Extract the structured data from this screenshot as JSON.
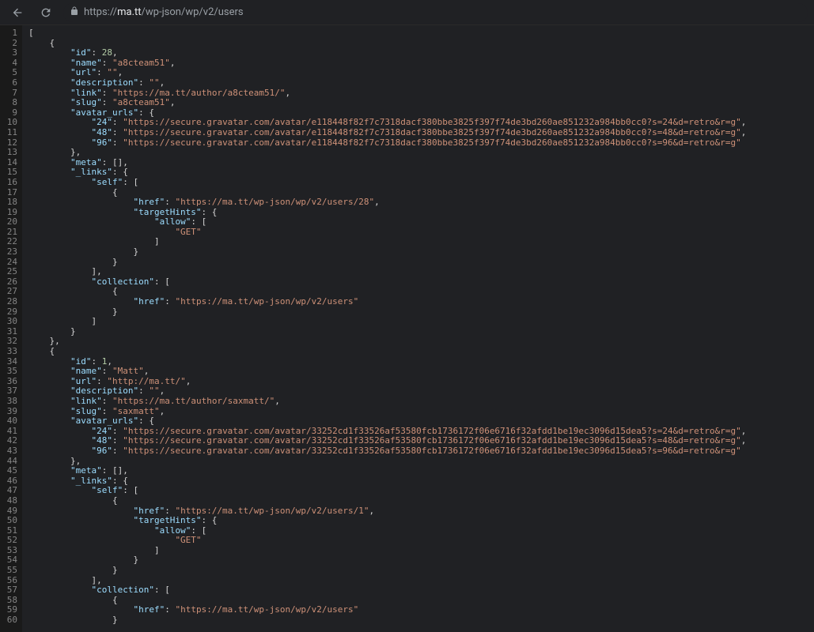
{
  "browser": {
    "url_prefix": "https://",
    "url_domain": "ma.tt",
    "url_path": "/wp-json/wp/v2/users"
  },
  "json_response": [
    {
      "id": 28,
      "name": "a8cteam51",
      "url": "",
      "description": "",
      "link": "https://ma.tt/author/a8cteam51/",
      "slug": "a8cteam51",
      "avatar_urls": {
        "24": "https://secure.gravatar.com/avatar/e118448f82f7c7318dacf380bbe3825f397f74de3bd260ae851232a984bb0cc0?s=24&d=retro&r=g",
        "48": "https://secure.gravatar.com/avatar/e118448f82f7c7318dacf380bbe3825f397f74de3bd260ae851232a984bb0cc0?s=48&d=retro&r=g",
        "96": "https://secure.gravatar.com/avatar/e118448f82f7c7318dacf380bbe3825f397f74de3bd260ae851232a984bb0cc0?s=96&d=retro&r=g"
      },
      "meta": [],
      "_links": {
        "self": [
          {
            "href": "https://ma.tt/wp-json/wp/v2/users/28",
            "targetHints": {
              "allow": [
                "GET"
              ]
            }
          }
        ],
        "collection": [
          {
            "href": "https://ma.tt/wp-json/wp/v2/users"
          }
        ]
      }
    },
    {
      "id": 1,
      "name": "Matt",
      "url": "http://ma.tt/",
      "description": "",
      "link": "https://ma.tt/author/saxmatt/",
      "slug": "saxmatt",
      "avatar_urls": {
        "24": "https://secure.gravatar.com/avatar/33252cd1f33526af53580fcb1736172f06e6716f32afdd1be19ec3096d15dea5?s=24&d=retro&r=g",
        "48": "https://secure.gravatar.com/avatar/33252cd1f33526af53580fcb1736172f06e6716f32afdd1be19ec3096d15dea5?s=48&d=retro&r=g",
        "96": "https://secure.gravatar.com/avatar/33252cd1f33526af53580fcb1736172f06e6716f32afdd1be19ec3096d15dea5?s=96&d=retro&r=g"
      },
      "meta": [],
      "_links": {
        "self": [
          {
            "href": "https://ma.tt/wp-json/wp/v2/users/1",
            "targetHints": {
              "allow": [
                "GET"
              ]
            }
          }
        ],
        "collection": [
          {
            "href": "https://ma.tt/wp-json/wp/v2/users"
          }
        ]
      }
    }
  ],
  "visible_lines": 60
}
